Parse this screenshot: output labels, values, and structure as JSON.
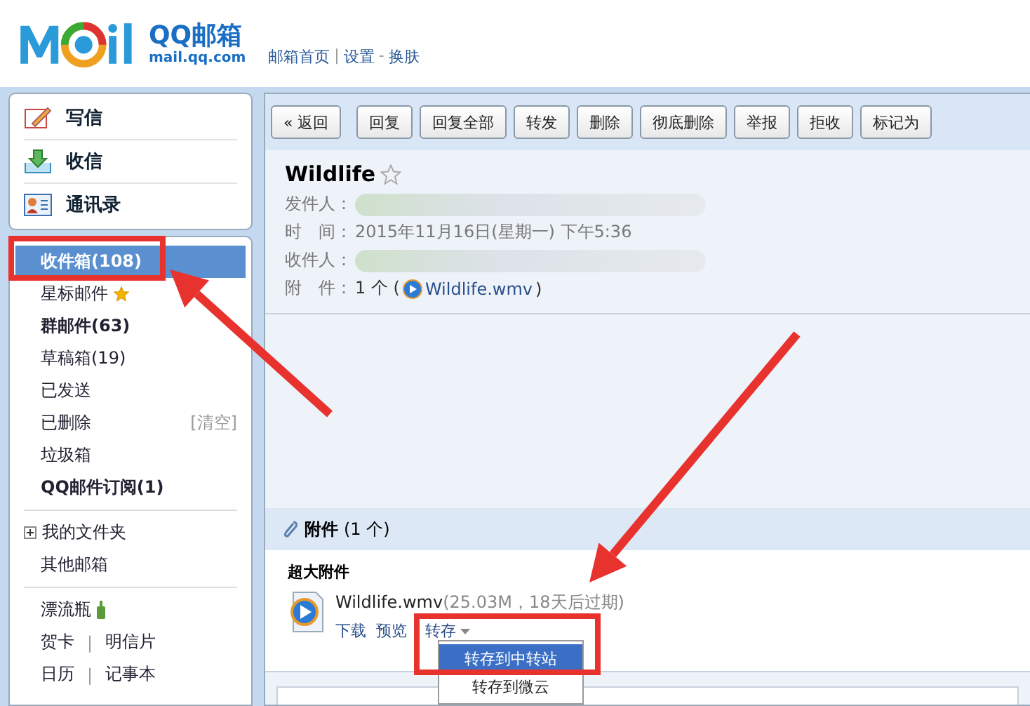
{
  "header": {
    "logo_title": "QQ邮箱",
    "logo_url": "mail.qq.com",
    "links": [
      {
        "label": "邮箱首页"
      },
      {
        "separator": "|",
        "label": "设置"
      },
      {
        "separator": "-",
        "label": "换肤"
      }
    ]
  },
  "quick_actions": [
    {
      "label": "写信",
      "kind": "compose"
    },
    {
      "label": "收信",
      "kind": "receive"
    },
    {
      "label": "通讯录",
      "kind": "contacts"
    }
  ],
  "folders": [
    {
      "label": "收件箱(108)",
      "selected": true,
      "bold": true
    },
    {
      "label": "星标邮件",
      "selected": false,
      "bold": false,
      "kind": "starred"
    },
    {
      "label": "群邮件(63)",
      "selected": false,
      "bold": true
    },
    {
      "label": "草稿箱(19)",
      "selected": false,
      "bold": false
    },
    {
      "label": "已发送",
      "selected": false,
      "bold": false
    },
    {
      "label": "已删除",
      "selected": false,
      "bold": false,
      "action": "[清空]"
    },
    {
      "label": "垃圾箱",
      "selected": false,
      "bold": false
    },
    {
      "label": "QQ邮件订阅(1)",
      "selected": false,
      "bold": true
    }
  ],
  "more_folders": [
    {
      "label": "我的文件夹",
      "expanded": false
    },
    {
      "label": "其他邮箱"
    }
  ],
  "apps": [
    {
      "items": [
        "漂流瓶"
      ],
      "kind": "bottle"
    },
    {
      "items": [
        "贺卡",
        "明信片"
      ],
      "separator": "|"
    },
    {
      "items": [
        "日历",
        "记事本"
      ],
      "separator": "|"
    }
  ],
  "toolbar": [
    "« 返回",
    "回复",
    "回复全部",
    "转发",
    "删除",
    "彻底删除",
    "举报",
    "拒收",
    "标记为"
  ],
  "mail": {
    "subject": "Wildlife",
    "starred": false,
    "fields": [
      {
        "label": "发件人：",
        "kind": "blurred"
      },
      {
        "label": "时　间：",
        "value": "2015年11月16日(星期一) 下午5:36"
      },
      {
        "label": "收件人：",
        "kind": "blurred"
      },
      {
        "label": "附　件：",
        "value": "1 个 (",
        "link": "Wildlife.wmv",
        "suffix": ")",
        "kind": "attachment"
      }
    ]
  },
  "attachments": {
    "title": "附件",
    "count": "(1 个)",
    "section": "超大附件",
    "file": "Wildlife.wmv",
    "meta": "(25.03M，18天后过期)",
    "actions": [
      "下载",
      "预览"
    ],
    "menu_button": "转存",
    "menu": [
      {
        "label": "转存到中转站",
        "selected": true
      },
      {
        "label": "转存到微云",
        "selected": false
      }
    ]
  }
}
